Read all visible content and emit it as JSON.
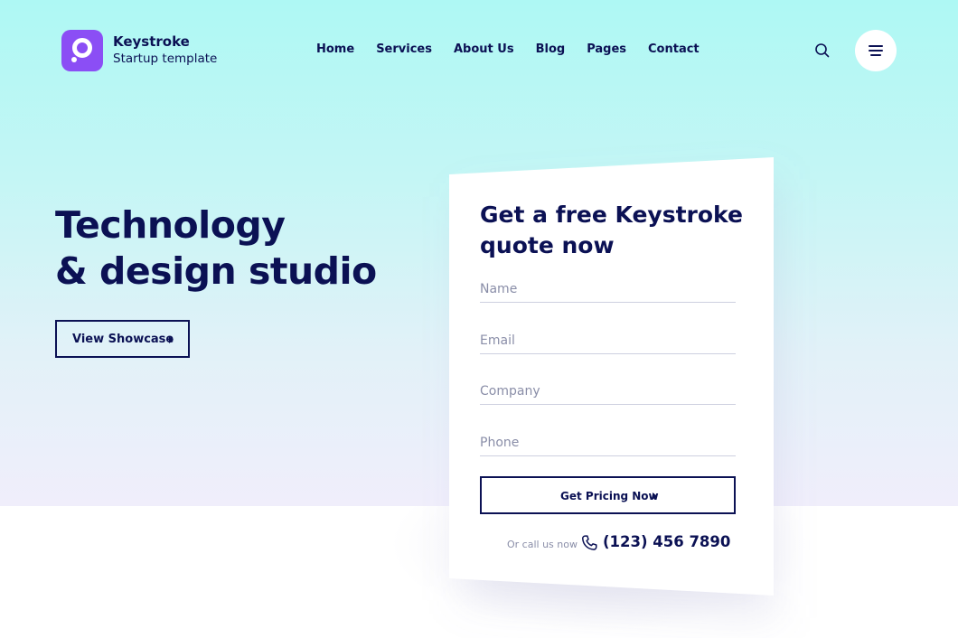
{
  "brand": {
    "name": "Keystroke",
    "tagline": "Startup template",
    "logo_color": "#8b4ef5"
  },
  "nav": {
    "items": [
      "Home",
      "Services",
      "About Us",
      "Blog",
      "Pages",
      "Contact"
    ]
  },
  "header": {
    "search_icon": "search-icon",
    "menu_icon": "hamburger-menu-icon"
  },
  "hero": {
    "title_line1": "Technology",
    "title_line2": "& design studio",
    "cta_label": "View Showcase"
  },
  "form": {
    "title": "Get a free Keystroke quote now",
    "fields": {
      "name": {
        "placeholder": "Name",
        "value": ""
      },
      "email": {
        "placeholder": "Email",
        "value": ""
      },
      "company": {
        "placeholder": "Company",
        "value": ""
      },
      "phone": {
        "placeholder": "Phone",
        "value": ""
      }
    },
    "submit_label": "Get Pricing Now",
    "call_label": "Or call us now",
    "phone_number": "(123) 456 7890"
  },
  "colors": {
    "primary_text": "#0b1154",
    "hero_gradient_top": "#aef8f4",
    "hero_gradient_bottom": "#f0eefb",
    "muted_text": "#8a8ea8"
  }
}
